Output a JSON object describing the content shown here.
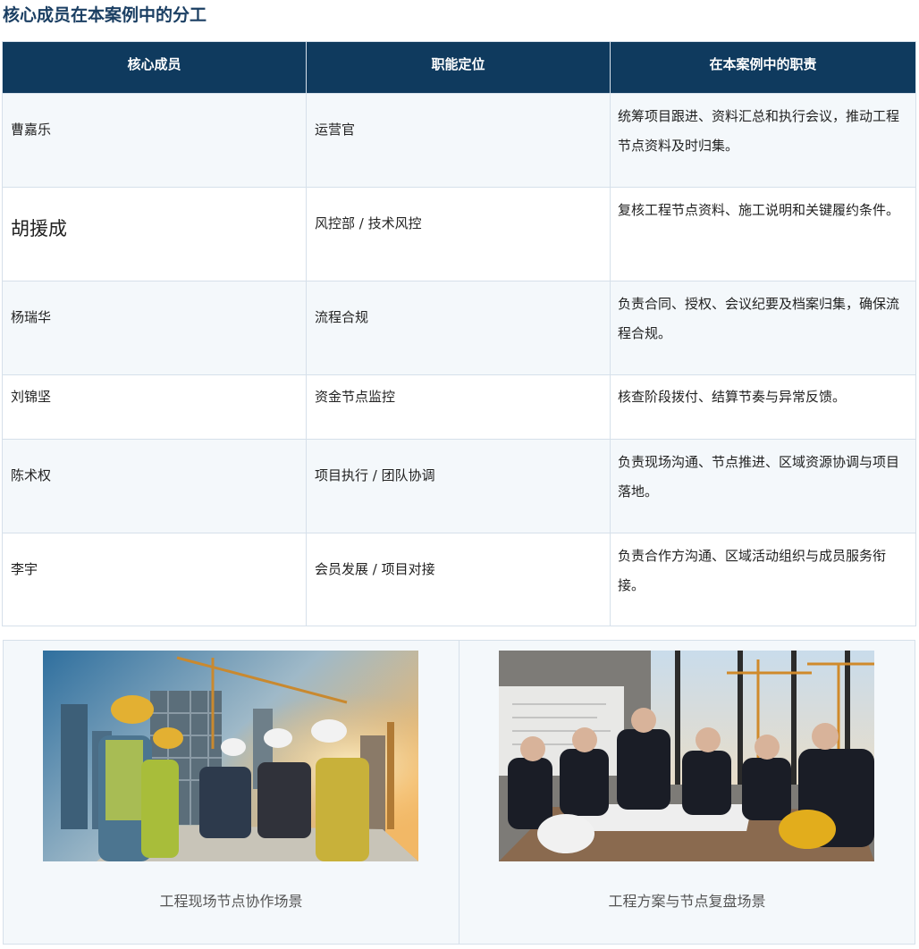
{
  "section_title": "核心成员在本案例中的分工",
  "table": {
    "headers": [
      "核心成员",
      "职能定位",
      "在本案例中的职责"
    ],
    "rows": [
      {
        "name": "曹嘉乐",
        "role": "运营官",
        "duty": "统筹项目跟进、资料汇总和执行会议，推动工程节点资料及时归集。"
      },
      {
        "name": "胡援成",
        "role": "风控部 / 技术风控",
        "duty": "复核工程节点资料、施工说明和关键履约条件。"
      },
      {
        "name": "杨瑞华",
        "role": "流程合规",
        "duty": "负责合同、授权、会议纪要及档案归集，确保流程合规。"
      },
      {
        "name": "刘锦坚",
        "role": "资金节点监控",
        "duty": "核查阶段拨付、结算节奏与异常反馈。"
      },
      {
        "name": "陈术权",
        "role": "项目执行 / 团队协调",
        "duty": "负责现场沟通、节点推进、区域资源协调与项目落地。"
      },
      {
        "name": "李宇",
        "role": "会员发展 / 项目对接",
        "duty": "负责合作方沟通、区域活动组织与成员服务衔接。"
      }
    ]
  },
  "gallery": [
    {
      "caption": "工程现场节点协作场景"
    },
    {
      "caption": "工程方案与节点复盘场景"
    }
  ],
  "colors": {
    "header_bg": "#0f3a5e",
    "title_text": "#1b3f63",
    "stripe": "#f4f8fb",
    "border": "#d6e0ea"
  }
}
